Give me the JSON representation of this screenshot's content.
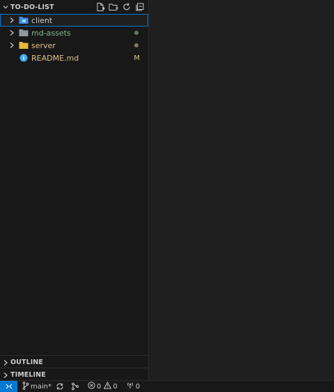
{
  "explorer": {
    "title": "TO-DO-LIST"
  },
  "tree": [
    {
      "name": "client",
      "kind": "folder",
      "color": "#cccccc",
      "decoration": ""
    },
    {
      "name": "md-assets",
      "kind": "folder",
      "color": "#81b88b",
      "decoration": "dot"
    },
    {
      "name": "server",
      "kind": "folder",
      "color": "#e2c08d",
      "decoration": "dot"
    },
    {
      "name": "README.md",
      "kind": "file",
      "color": "#e2c08d",
      "decoration": "M"
    }
  ],
  "panels": {
    "outline": "OUTLINE",
    "timeline": "TIMELINE"
  },
  "status": {
    "branch": "main*",
    "errors": "0",
    "warnings": "0",
    "ports": "0"
  },
  "colors": {
    "accent": "#0078d4",
    "modified": "#e2c08d",
    "added": "#81b88b"
  }
}
